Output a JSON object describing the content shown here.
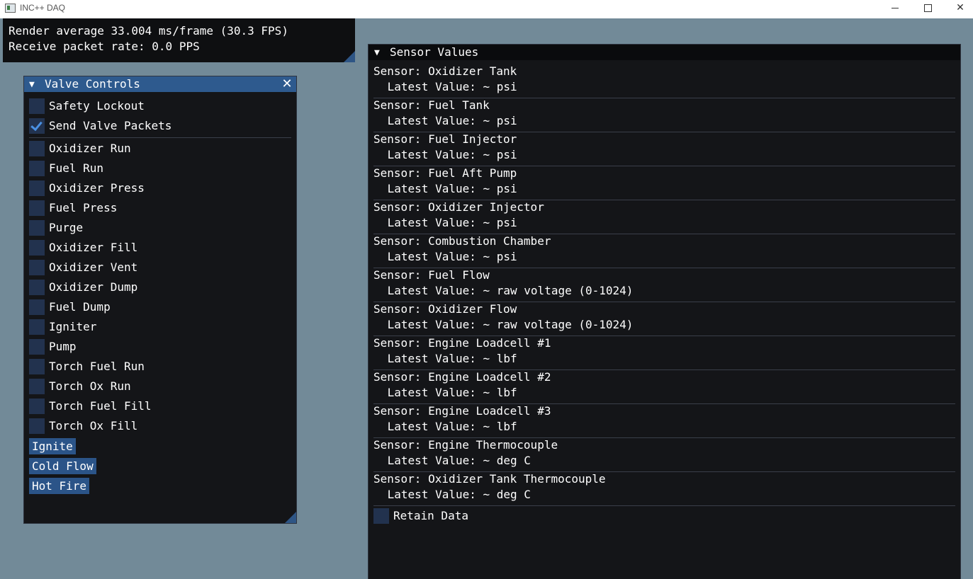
{
  "window": {
    "title": "INC++ DAQ",
    "minimize_glyph": "minimize-icon",
    "maximize_glyph": "maximize-icon",
    "close_glyph": "✕"
  },
  "overlay": {
    "render_line": "Render average 33.004 ms/frame (30.3 FPS)",
    "packet_line": "Receive packet rate: 0.0 PPS"
  },
  "valve_controls": {
    "arrow": "▼",
    "title": "Valve Controls",
    "close": "✕",
    "toggles": [
      {
        "label": "Safety Lockout",
        "checked": false
      },
      {
        "label": "Send Valve Packets",
        "checked": true
      }
    ],
    "valves": [
      {
        "label": "Oxidizer Run",
        "checked": false
      },
      {
        "label": "Fuel Run",
        "checked": false
      },
      {
        "label": "Oxidizer Press",
        "checked": false
      },
      {
        "label": "Fuel Press",
        "checked": false
      },
      {
        "label": "Purge",
        "checked": false
      },
      {
        "label": "Oxidizer Fill",
        "checked": false
      },
      {
        "label": "Oxidizer Vent",
        "checked": false
      },
      {
        "label": "Oxidizer Dump",
        "checked": false
      },
      {
        "label": "Fuel Dump",
        "checked": false
      },
      {
        "label": "Igniter",
        "checked": false
      },
      {
        "label": "Pump",
        "checked": false
      },
      {
        "label": "Torch Fuel Run",
        "checked": false
      },
      {
        "label": "Torch Ox Run",
        "checked": false
      },
      {
        "label": "Torch Fuel Fill",
        "checked": false
      },
      {
        "label": "Torch Ox Fill",
        "checked": false
      }
    ],
    "buttons": [
      "Ignite",
      "Cold Flow",
      "Hot Fire"
    ]
  },
  "sensor_values": {
    "arrow": "▼",
    "title": "Sensor Values",
    "sensors": [
      {
        "name": "Sensor: Oxidizer Tank",
        "value": " Latest Value: ~ psi"
      },
      {
        "name": "Sensor: Fuel Tank",
        "value": " Latest Value: ~ psi"
      },
      {
        "name": "Sensor: Fuel Injector",
        "value": " Latest Value: ~ psi"
      },
      {
        "name": "Sensor: Fuel Aft Pump",
        "value": " Latest Value: ~ psi"
      },
      {
        "name": "Sensor: Oxidizer Injector",
        "value": " Latest Value: ~ psi"
      },
      {
        "name": "Sensor: Combustion Chamber",
        "value": " Latest Value: ~ psi"
      },
      {
        "name": "Sensor: Fuel Flow",
        "value": " Latest Value: ~ raw voltage (0-1024)"
      },
      {
        "name": "Sensor: Oxidizer Flow",
        "value": " Latest Value: ~ raw voltage (0-1024)"
      },
      {
        "name": "Sensor: Engine Loadcell #1",
        "value": " Latest Value: ~ lbf"
      },
      {
        "name": "Sensor: Engine Loadcell #2",
        "value": " Latest Value: ~ lbf"
      },
      {
        "name": "Sensor: Engine Loadcell #3",
        "value": " Latest Value: ~ lbf"
      },
      {
        "name": "Sensor: Engine Thermocouple",
        "value": " Latest Value: ~ deg C"
      },
      {
        "name": "Sensor: Oxidizer Tank Thermocouple",
        "value": " Latest Value: ~ deg C"
      }
    ],
    "retain": {
      "label": "Retain Data",
      "checked": false
    }
  }
}
